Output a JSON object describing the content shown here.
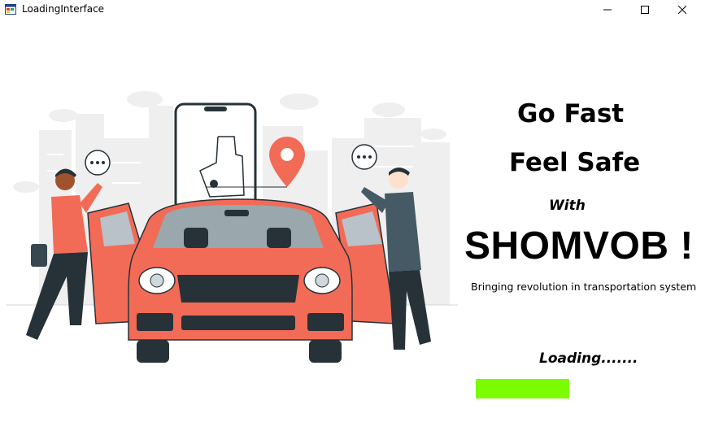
{
  "window": {
    "title": "LoadingInterface",
    "icon": "app-window-icon",
    "controls": [
      "minimize-icon",
      "maximize-icon",
      "close-icon"
    ]
  },
  "headline": {
    "line1": "Go Fast",
    "line2": "Feel Safe",
    "line3": "With"
  },
  "brand": {
    "name": "SHOMVOB !",
    "tagline": "Bringing revolution in transportation system"
  },
  "loading": {
    "label": "Loading.......",
    "progress": 0.5,
    "bar_color": "#7cfc00"
  },
  "illustration": {
    "car_color": "#f26b57",
    "pin_color": "#f26b57"
  }
}
